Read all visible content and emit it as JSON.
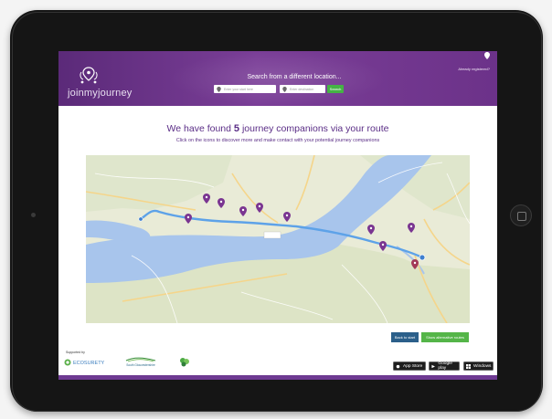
{
  "app": {
    "logo_text": "joinmyjourney",
    "search_title": "Search from a different location...",
    "start_placeholder": "Enter your start here",
    "destination_placeholder": "Enter destination",
    "search_button": "Search",
    "registered_link": "Already registered?"
  },
  "results": {
    "heading_prefix": "We have found",
    "count": "5",
    "heading_suffix": "journey companions via your route",
    "subheading": "Click on the icons to discover more and make contact with your potential journey companions"
  },
  "actions": {
    "back_label": "Back to start",
    "alternative_label": "Show alternative routes"
  },
  "footer": {
    "supported_by": "Supported by",
    "sponsor_ecosurety": "ECOSURETY",
    "sponsor_south_glos": "South Gloucestershire",
    "store_app": "App Store",
    "store_google": "Google play",
    "store_windows": "Windows"
  },
  "colors": {
    "brand_purple": "#6c3289",
    "action_blue": "#2b5f8a",
    "action_green": "#54b548",
    "route_blue": "#5da2e8",
    "companion_marker": "#7a3591",
    "estuary_water": "#a8c5ec"
  },
  "icons": [
    "location-pin-logo-icon",
    "pin-icon",
    "companion-marker-icon",
    "apple-icon",
    "google-play-icon",
    "windows-icon"
  ]
}
